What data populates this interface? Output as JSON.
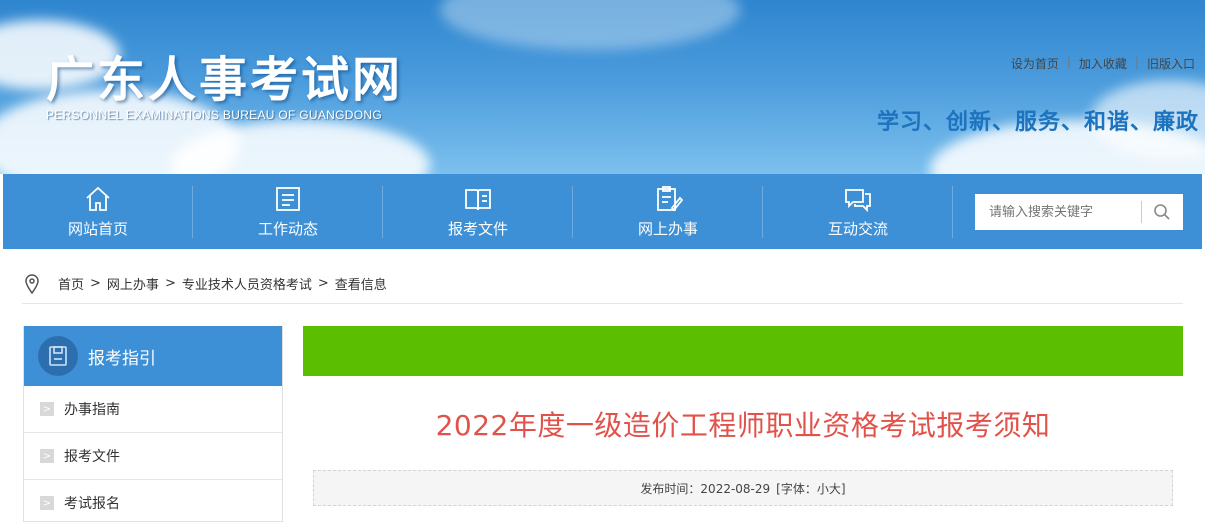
{
  "header": {
    "logo_cn": "广东人事考试网",
    "logo_en": "PERSONNEL EXAMINATIONS BUREAU OF GUANGDONG",
    "top_links": [
      "设为首页",
      "加入收藏",
      "旧版入口"
    ],
    "slogan": "学习、创新、服务、和谐、廉政"
  },
  "nav": {
    "items": [
      {
        "label": "网站首页",
        "icon": "home-icon"
      },
      {
        "label": "工作动态",
        "icon": "news-icon"
      },
      {
        "label": "报考文件",
        "icon": "book-icon"
      },
      {
        "label": "网上办事",
        "icon": "clipboard-edit-icon"
      },
      {
        "label": "互动交流",
        "icon": "chat-icon"
      }
    ],
    "search_placeholder": "请输入搜索关键字"
  },
  "breadcrumb": [
    "首页",
    "网上办事",
    "专业技术人员资格考试",
    "查看信息"
  ],
  "sidebar": {
    "title": "报考指引",
    "items": [
      "办事指南",
      "报考文件",
      "考试报名"
    ]
  },
  "article": {
    "title": "2022年度一级造价工程师职业资格考试报考须知",
    "meta_publish": "发布时间：2022-08-29",
    "meta_font_label": "[字体：",
    "meta_font_small": "小",
    "meta_font_large": "大",
    "meta_font_end": "]"
  },
  "colors": {
    "nav_bg": "#3d8fd6",
    "green_bar": "#5cbe00",
    "title_red": "#e1524a",
    "slogan_blue": "#1e73be"
  }
}
